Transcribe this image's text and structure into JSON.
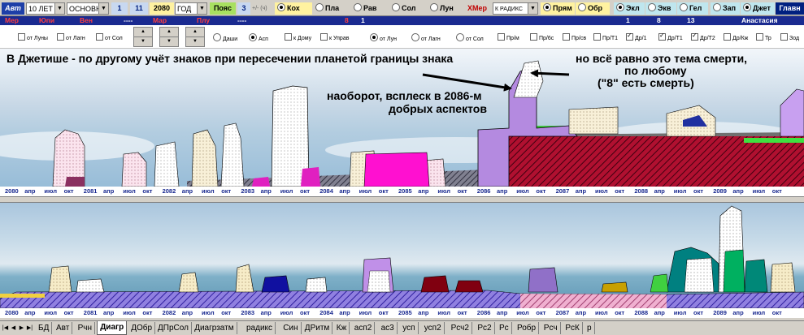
{
  "toolbar": {
    "auto_label": "Авт",
    "period_value": "10 ЛЕТ",
    "mode_value": "ОСНОВН",
    "n1": "1",
    "n11": "11",
    "year": "2080",
    "year_unit": "ГОД",
    "zone_label": "Пояс",
    "zone_value": "3",
    "plusminus": "+/- (ч)",
    "planet_radios": [
      "Кох",
      "Пла",
      "Рав",
      "Сол",
      "Лун",
      "Мер"
    ],
    "radix_value": "К РАДИКС",
    "direction_radios": [
      "Прям",
      "Обр"
    ],
    "system_radios": [
      "Экл",
      "Экв",
      "Гел"
    ],
    "zodiac_radios": [
      "Зап",
      "Джет"
    ],
    "main_label": "Главн"
  },
  "row2": {
    "planets": [
      "Мер",
      "Юпи",
      "Вен",
      "----",
      "Мар",
      "Плу",
      "----"
    ],
    "num8": "8",
    "num1": "1",
    "nums_right": [
      "1",
      "8",
      "13"
    ],
    "name": "Анастасия"
  },
  "controls": {
    "left_checks": [
      "от Луны",
      "от Лагн",
      "от Сол"
    ],
    "mid_radios": [
      "Даши",
      "Асп"
    ],
    "mid_checks": [
      "к Дому",
      "к Управ"
    ],
    "right_radios": [
      "от Лун",
      "от Лагн",
      "от Сол"
    ],
    "right_checks": [
      {
        "label": "Пр/м",
        "checked": false
      },
      {
        "label": "Пр/6с",
        "checked": false
      },
      {
        "label": "Пр/св",
        "checked": false
      },
      {
        "label": "Пр/Т1",
        "checked": false
      },
      {
        "label": "Др/1",
        "checked": true
      },
      {
        "label": "Др/Т1",
        "checked": true
      },
      {
        "label": "Др/Т2",
        "checked": true
      },
      {
        "label": "Др/Кж",
        "checked": false
      },
      {
        "label": "Тр",
        "checked": false
      },
      {
        "label": "Зод",
        "checked": false
      }
    ]
  },
  "annotations": {
    "line1": "В Джетише - по другому учёт знаков при пересечении планетой границы знака",
    "right1": "но всё равно это тема смерти,",
    "right2": "по любому",
    "right3": "(\"8\" есть смерть)",
    "mid1": "наоборот, всплеск в 2086-м",
    "mid2": "добрых аспектов"
  },
  "axis": [
    "2080",
    "апр",
    "июл",
    "окт",
    "2081",
    "апр",
    "июл",
    "окт",
    "2082",
    "апр",
    "июл",
    "окт",
    "2083",
    "апр",
    "июл",
    "окт",
    "2084",
    "апр",
    "июл",
    "окт",
    "2085",
    "апр",
    "июл",
    "окт",
    "2086",
    "апр",
    "июл",
    "окт",
    "2087",
    "апр",
    "июл",
    "окт",
    "2088",
    "апр",
    "июл",
    "окт",
    "2089",
    "апр",
    "июл",
    "окт"
  ],
  "tabs": [
    "БД",
    "Авт",
    "Рчн",
    "Диагр",
    "ДОбр",
    "ДПрСол",
    "Диагрзатм",
    "радикс",
    "Син",
    "ДРитм",
    "Кж",
    "асп2",
    "ас3",
    "усп",
    "усп2",
    "Рсч2",
    "Рс2",
    "Рс",
    "Робр",
    "Рсч",
    "РсК",
    "р"
  ],
  "active_tab": "Диагр"
}
